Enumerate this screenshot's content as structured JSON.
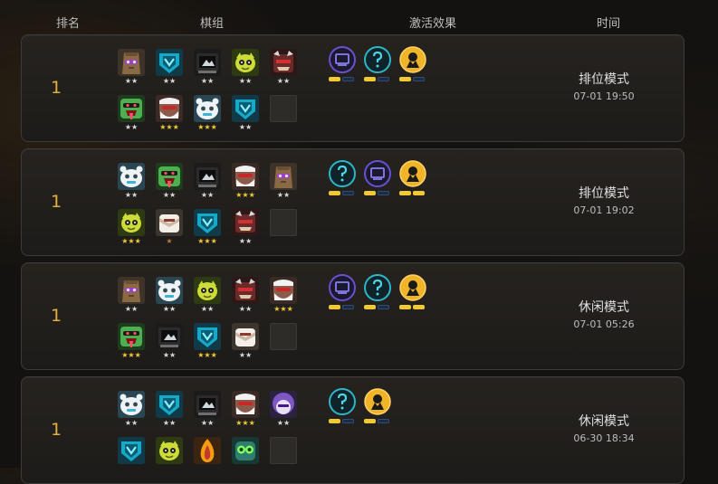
{
  "header": {
    "rank": "排名",
    "lineup": "棋组",
    "traits": "激活效果",
    "time": "时间"
  },
  "colors": {
    "gold": "#e3b03a",
    "star_gold": "#f1c933",
    "star_silver": "#d9d9d9",
    "star_bronze": "#b8783a"
  },
  "rows": [
    {
      "rank": "1",
      "mode": "排位模式",
      "time": "07-01 19:50",
      "units": [
        {
          "icon": "bag-mask-unit-icon",
          "stars": "★★"
        },
        {
          "icon": "shield-cyan-unit-icon",
          "stars": "★★"
        },
        {
          "icon": "dark-screen-unit-icon",
          "stars": "★★"
        },
        {
          "icon": "yellow-bulb-unit-icon",
          "stars": "★★"
        },
        {
          "icon": "red-beast-unit-icon",
          "stars": "★★"
        },
        {
          "icon": "green-tongue-unit-icon",
          "stars": "★★"
        },
        {
          "icon": "white-beard-unit-icon",
          "stars": "★★★"
        },
        {
          "icon": "white-bear-unit-icon",
          "stars": "★★★"
        },
        {
          "icon": "shield-cyan-unit-icon",
          "stars": "★★"
        }
      ],
      "traits": [
        {
          "icon": "purple-screen-trait-icon",
          "color": "#6a4fd1",
          "tier": 1
        },
        {
          "icon": "cyan-question-trait-icon",
          "color": "#2bb7c9",
          "tier": 1
        },
        {
          "icon": "gold-emblem-trait-icon",
          "color": "#e0a82e",
          "tier": 1
        }
      ]
    },
    {
      "rank": "1",
      "mode": "排位模式",
      "time": "07-01 19:02",
      "units": [
        {
          "icon": "white-bear-unit-icon",
          "stars": "★★"
        },
        {
          "icon": "green-tongue-unit-icon",
          "stars": "★★"
        },
        {
          "icon": "dark-screen-unit-icon",
          "stars": "★★"
        },
        {
          "icon": "white-beard-unit-icon",
          "stars": "★★★"
        },
        {
          "icon": "bag-mask-unit-icon",
          "stars": "★★"
        },
        {
          "icon": "yellow-bulb-unit-icon",
          "stars": "★★★"
        },
        {
          "icon": "white-fluff-unit-icon",
          "stars": "★"
        },
        {
          "icon": "shield-cyan-unit-icon",
          "stars": "★★★"
        },
        {
          "icon": "red-beast-unit-icon",
          "stars": "★★"
        }
      ],
      "traits": [
        {
          "icon": "cyan-question-trait-icon",
          "color": "#2bb7c9",
          "tier": 1
        },
        {
          "icon": "purple-screen-trait-icon",
          "color": "#6a4fd1",
          "tier": 1
        },
        {
          "icon": "gold-emblem-trait-icon",
          "color": "#e0a82e",
          "tier": 2
        }
      ]
    },
    {
      "rank": "1",
      "mode": "休闲模式",
      "time": "07-01 05:26",
      "units": [
        {
          "icon": "bag-mask-unit-icon",
          "stars": "★★"
        },
        {
          "icon": "white-bear-unit-icon",
          "stars": "★★"
        },
        {
          "icon": "yellow-bulb-unit-icon",
          "stars": "★★"
        },
        {
          "icon": "red-beast-unit-icon",
          "stars": "★★"
        },
        {
          "icon": "white-beard-unit-icon",
          "stars": "★★★"
        },
        {
          "icon": "green-tongue-unit-icon",
          "stars": "★★★"
        },
        {
          "icon": "dark-screen-unit-icon",
          "stars": "★★"
        },
        {
          "icon": "shield-cyan-unit-icon",
          "stars": "★★★"
        },
        {
          "icon": "white-fluff-unit-icon",
          "stars": "★★"
        }
      ],
      "traits": [
        {
          "icon": "purple-screen-trait-icon",
          "color": "#6a4fd1",
          "tier": 1
        },
        {
          "icon": "cyan-question-trait-icon",
          "color": "#2bb7c9",
          "tier": 1
        },
        {
          "icon": "gold-emblem-trait-icon",
          "color": "#e0a82e",
          "tier": 2
        }
      ]
    },
    {
      "rank": "1",
      "mode": "休闲模式",
      "time": "06-30 18:34",
      "units": [
        {
          "icon": "white-bear-unit-icon",
          "stars": "★★"
        },
        {
          "icon": "shield-cyan-unit-icon",
          "stars": "★★"
        },
        {
          "icon": "dark-screen-unit-icon",
          "stars": "★★"
        },
        {
          "icon": "white-beard-unit-icon",
          "stars": "★★★"
        },
        {
          "icon": "purple-hair-unit-icon",
          "stars": "★★"
        },
        {
          "icon": "shield-cyan-unit-icon",
          "stars": ""
        },
        {
          "icon": "yellow-bulb-unit-icon",
          "stars": ""
        },
        {
          "icon": "orange-flame-unit-icon",
          "stars": ""
        },
        {
          "icon": "green-goggles-unit-icon",
          "stars": ""
        }
      ],
      "traits": [
        {
          "icon": "cyan-question-trait-icon",
          "color": "#2bb7c9",
          "tier": 1
        },
        {
          "icon": "gold-emblem-trait-icon",
          "color": "#e0a82e",
          "tier": 1
        }
      ]
    }
  ]
}
